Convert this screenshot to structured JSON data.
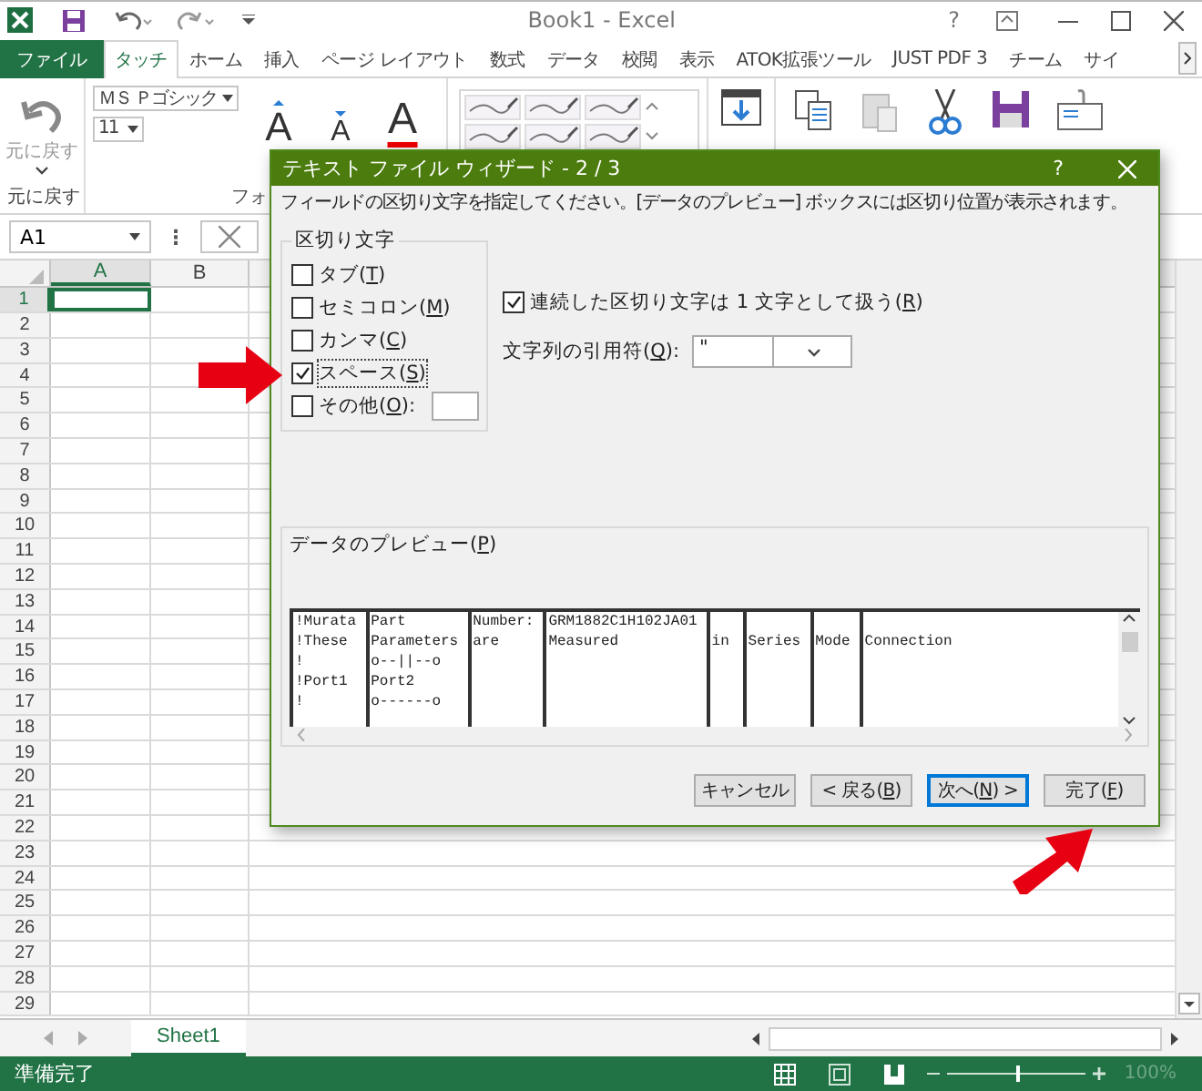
{
  "title_bar": {
    "title": "Book1 - Excel",
    "help": "?"
  },
  "ribbon_tabs": [
    {
      "label": "ファイル",
      "kind": "file",
      "selected": false
    },
    {
      "label": "タッチ",
      "kind": "tab",
      "selected": true
    },
    {
      "label": "ホーム",
      "kind": "tab",
      "selected": false
    },
    {
      "label": "挿入",
      "kind": "tab",
      "selected": false
    },
    {
      "label": "ページ レイアウト",
      "kind": "tab",
      "selected": false
    },
    {
      "label": "数式",
      "kind": "tab",
      "selected": false
    },
    {
      "label": "データ",
      "kind": "tab",
      "selected": false
    },
    {
      "label": "校閲",
      "kind": "tab",
      "selected": false
    },
    {
      "label": "表示",
      "kind": "tab",
      "selected": false
    },
    {
      "label": "ATOK拡張ツール",
      "kind": "tab",
      "selected": false
    },
    {
      "label": "JUST PDF 3",
      "kind": "tab",
      "selected": false
    },
    {
      "label": "チーム",
      "kind": "tab",
      "selected": false
    },
    {
      "label": "サイ",
      "kind": "tab",
      "selected": false
    }
  ],
  "ribbon": {
    "undo_label": "元に戻す",
    "undo_group": "元に戻す",
    "font_name": "ＭＳ Ｐゴシック",
    "font_size": "11",
    "font_group": "フォ",
    "font_buttons": [
      {
        "glyph": "A",
        "kind": "grow"
      },
      {
        "glyph": "A",
        "kind": "shrink"
      },
      {
        "glyph": "A",
        "kind": "color"
      }
    ]
  },
  "formula_bar": {
    "name_box": "A1",
    "more": "⋮"
  },
  "sheet": {
    "columns": [
      {
        "label": "A",
        "selected": true
      },
      {
        "label": "B",
        "selected": false
      }
    ],
    "rows": [
      {
        "label": "1",
        "selected": true
      },
      {
        "label": "2",
        "selected": false
      },
      {
        "label": "3",
        "selected": false
      },
      {
        "label": "4",
        "selected": false
      },
      {
        "label": "5",
        "selected": false
      },
      {
        "label": "6",
        "selected": false
      },
      {
        "label": "7",
        "selected": false
      },
      {
        "label": "8",
        "selected": false
      },
      {
        "label": "9",
        "selected": false
      },
      {
        "label": "10",
        "selected": false
      },
      {
        "label": "11",
        "selected": false
      },
      {
        "label": "12",
        "selected": false
      },
      {
        "label": "13",
        "selected": false
      },
      {
        "label": "14",
        "selected": false
      },
      {
        "label": "15",
        "selected": false
      },
      {
        "label": "16",
        "selected": false
      },
      {
        "label": "17",
        "selected": false
      },
      {
        "label": "18",
        "selected": false
      },
      {
        "label": "19",
        "selected": false
      },
      {
        "label": "20",
        "selected": false
      },
      {
        "label": "21",
        "selected": false
      },
      {
        "label": "22",
        "selected": false
      },
      {
        "label": "23",
        "selected": false
      },
      {
        "label": "24",
        "selected": false
      },
      {
        "label": "25",
        "selected": false
      },
      {
        "label": "26",
        "selected": false
      },
      {
        "label": "27",
        "selected": false
      },
      {
        "label": "28",
        "selected": false
      },
      {
        "label": "29",
        "selected": false
      }
    ]
  },
  "sheet_tabs": [
    {
      "label": "Sheet1",
      "selected": true
    }
  ],
  "status_bar": {
    "text": "準備完了",
    "zoom": "100%",
    "zoom_slider": {
      "level": 0.5
    }
  },
  "dialog": {
    "title": "テキスト ファイル ウィザード - 2 / 3",
    "help": "?",
    "instruction": "フィールドの区切り文字を指定してください。[データのプレビュー] ボックスには区切り位置が表示されます。",
    "delimiters": {
      "title": "区切り文字",
      "options": [
        {
          "label": "タブ(T)",
          "kind": "plain",
          "checked": false
        },
        {
          "label": "セミコロン(M)",
          "kind": "plain",
          "checked": false
        },
        {
          "label": "カンマ(C)",
          "kind": "plain",
          "checked": false
        },
        {
          "label": "スペース(S)",
          "kind": "plain",
          "checked": true
        },
        {
          "label": "その他(O):",
          "kind": "other",
          "checked": false
        }
      ]
    },
    "consecutive": {
      "label": "連続した区切り文字は 1 文字として扱う(R)",
      "checked": true
    },
    "quote": {
      "label": "文字列の引用符(Q):",
      "value": "\""
    },
    "preview": {
      "title": "データのプレビュー(P)",
      "rows": [
        {
          "cells": [
            "!Murata",
            "Part",
            "Number:",
            "GRM1882C1H102JA01"
          ]
        },
        {
          "cells": [
            "!These",
            "Parameters",
            "are",
            "Measured",
            "in",
            "Series",
            "Mode",
            "Connection"
          ]
        },
        {
          "cells": [
            "!",
            "o--||--o"
          ]
        },
        {
          "cells": [
            "!Port1",
            "Port2"
          ]
        },
        {
          "cells": [
            "!",
            "o------o"
          ]
        }
      ]
    },
    "buttons": [
      {
        "label": "キャンセル",
        "default": false
      },
      {
        "label": "< 戻る(B)",
        "default": false
      },
      {
        "label": "次へ(N) >",
        "default": true
      },
      {
        "label": "完了(F)",
        "default": false
      }
    ]
  }
}
